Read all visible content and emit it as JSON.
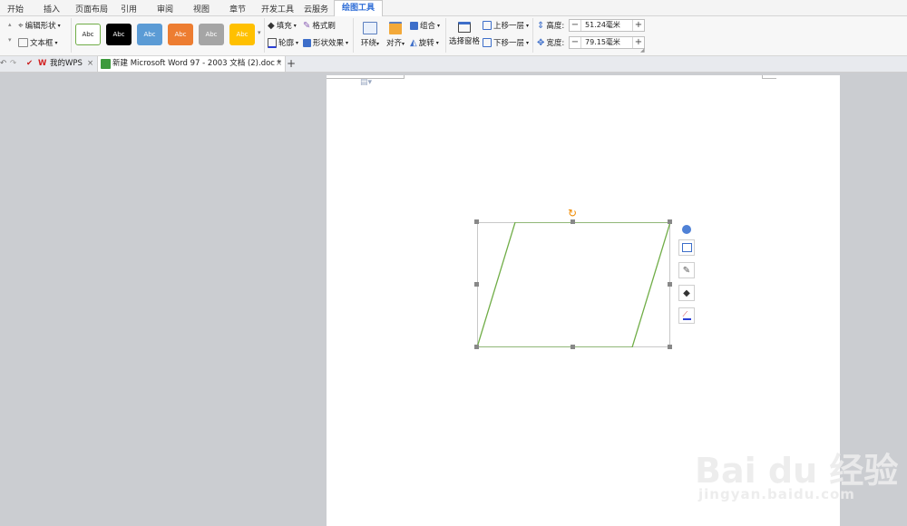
{
  "menu": {
    "tabs": [
      "开始",
      "插入",
      "页面布局",
      "引用",
      "审阅",
      "视图",
      "章节",
      "开发工具",
      "云服务",
      "绘图工具"
    ],
    "active_tab": "绘图工具"
  },
  "ribbon": {
    "edit_shape": "编辑形状",
    "text_box": "文本框",
    "style_label": "Abc",
    "style_colors": [
      "#ffffff",
      "#000000",
      "#5b9bd5",
      "#ed7d31",
      "#a5a5a5",
      "#ffc000"
    ],
    "fill": "填充",
    "format_painter": "格式刷",
    "outline": "轮廓",
    "shape_effects": "形状效果",
    "wrap": "环绕",
    "align": "对齐",
    "group": "组合",
    "rotate": "旋转",
    "selection_pane": "选择窗格",
    "bring_forward": "上移一层",
    "send_backward": "下移一层",
    "height_label": "高度:",
    "height_value": "51.24毫米",
    "width_label": "宽度:",
    "width_value": "79.15毫米",
    "minus": "−",
    "plus": "+"
  },
  "tabs": {
    "wps_tab": "我的WPS",
    "doc_tab": "新建 Microsoft Word 97 - 2003 文档 (2).doc *",
    "close": "×",
    "new_tab": "+"
  },
  "shape": {
    "outline_color": "#70ad47"
  },
  "watermark": {
    "brand": "Bai du 经验",
    "url": "jingyan.baidu.com"
  },
  "colors": {
    "accent": "#2b6bd6",
    "page_bg": "#cbcdd1"
  }
}
